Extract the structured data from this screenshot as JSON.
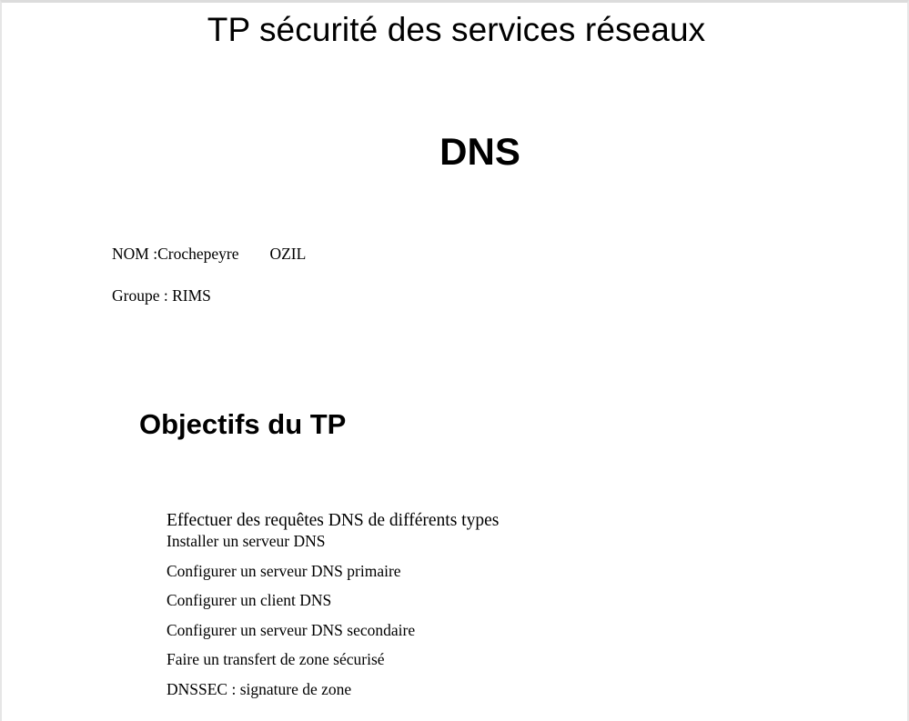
{
  "document": {
    "title": "TP sécurité des services réseaux",
    "heading": "DNS",
    "name_label": "NOM :Crochepeyre",
    "name_second": "OZIL",
    "group": "Groupe : RIMS",
    "section_title": "Objectifs du TP",
    "objectives": [
      "Effectuer des requêtes DNS de différents types",
      "Installer un serveur DNS",
      "Configurer un serveur DNS primaire",
      "Configurer un client DNS",
      "Configurer un serveur DNS secondaire",
      "Faire un transfert de zone sécurisé",
      "DNSSEC : signature de zone"
    ]
  }
}
